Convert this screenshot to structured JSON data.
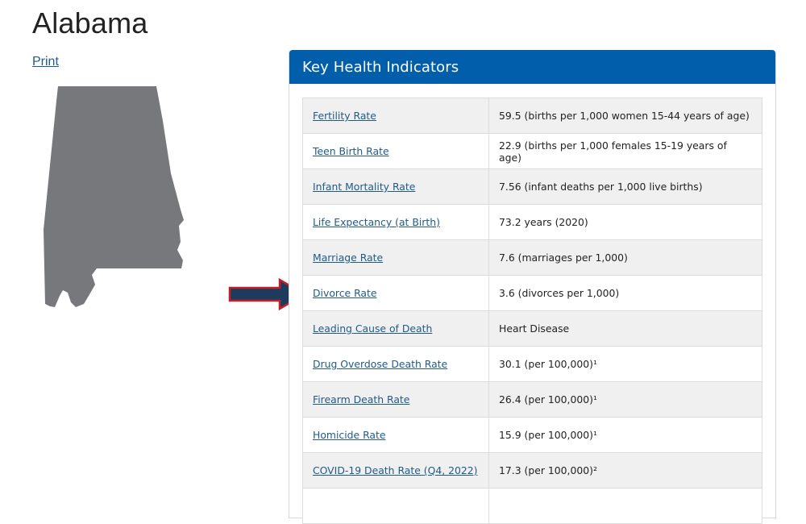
{
  "page": {
    "title": "Alabama",
    "print_label": "Print"
  },
  "map": {
    "state": "Alabama",
    "fill_color": "#77787b"
  },
  "annotation": {
    "type": "arrow",
    "points_to": "Divorce Rate",
    "fill_color": "#1e3a5c",
    "outline_color": "#c0202a"
  },
  "panel": {
    "header": "Key Health Indicators",
    "header_color": "#005eaa",
    "rows": [
      {
        "label": "Fertility Rate",
        "value": "59.5 (births per 1,000 women 15-44 years of age)"
      },
      {
        "label": "Teen Birth Rate",
        "value": "22.9 (births per 1,000 females 15-19 years of age)"
      },
      {
        "label": "Infant Mortality Rate",
        "value": "7.56 (infant deaths per 1,000 live births)"
      },
      {
        "label": "Life Expectancy (at Birth)",
        "value": "73.2 years (2020)"
      },
      {
        "label": "Marriage Rate",
        "value": "7.6 (marriages per 1,000)"
      },
      {
        "label": "Divorce Rate",
        "value": "3.6 (divorces per 1,000)"
      },
      {
        "label": "Leading Cause of Death",
        "value": "Heart Disease"
      },
      {
        "label": "Drug Overdose Death Rate",
        "value": "30.1 (per 100,000)¹"
      },
      {
        "label": "Firearm Death Rate",
        "value": "26.4 (per 100,000)¹"
      },
      {
        "label": "Homicide Rate",
        "value": "15.9 (per 100,000)¹"
      },
      {
        "label": "COVID-19 Death Rate (Q4, 2022)",
        "value": "17.3 (per 100,000)²"
      },
      {
        "label": "",
        "value": ""
      }
    ]
  }
}
